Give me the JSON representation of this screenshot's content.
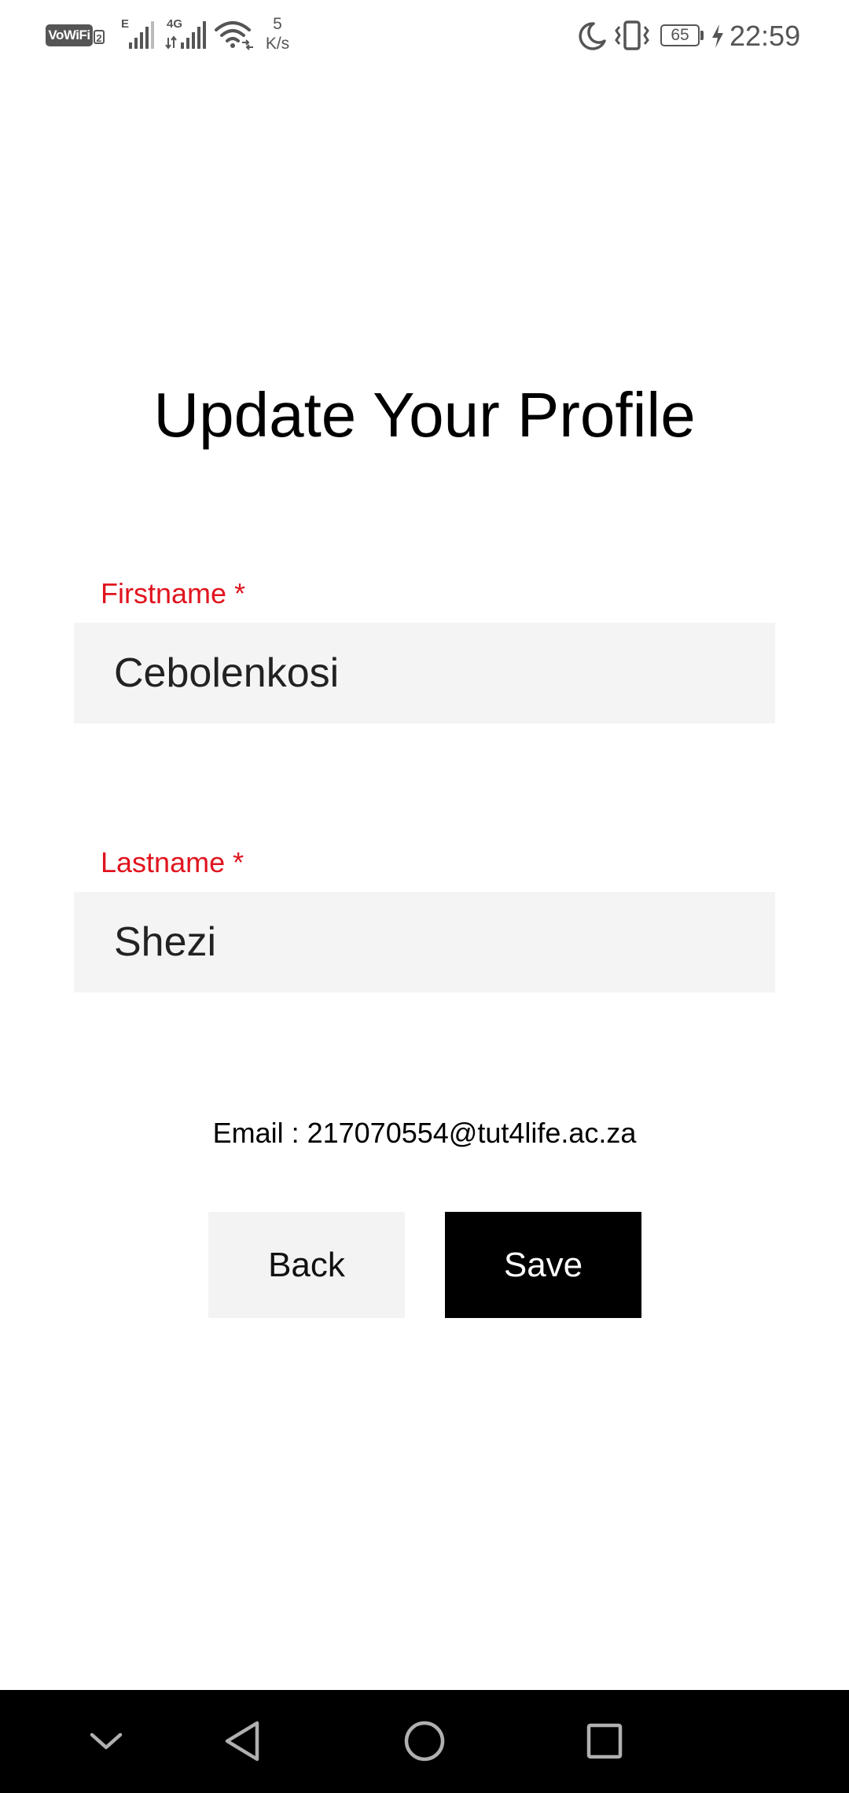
{
  "status_bar": {
    "vowifi_label": "VoWiFi",
    "vowifi_sim": "2",
    "network_type_1": "E",
    "network_type_2": "4G",
    "net_speed_value": "5",
    "net_speed_unit": "K/s",
    "battery_level": "65",
    "time": "22:59",
    "icons": [
      "vowifi-icon",
      "signal-icon",
      "signal-4g-icon",
      "wifi-icon",
      "moon-icon",
      "vibrate-icon",
      "battery-icon",
      "charging-icon"
    ]
  },
  "page": {
    "title": "Update Your Profile"
  },
  "form": {
    "firstname_label": "Firstname *",
    "firstname_value": "Cebolenkosi",
    "lastname_label": "Lastname *",
    "lastname_value": "Shezi",
    "email_text": "Email : 217070554@tut4life.ac.za"
  },
  "buttons": {
    "back_label": "Back",
    "save_label": "Save"
  },
  "nav_bar": {
    "icons": [
      "chevron-down-icon",
      "back-triangle-icon",
      "home-circle-icon",
      "recents-square-icon"
    ]
  },
  "colors": {
    "label_red": "#e0141e",
    "field_bg": "#f4f4f4",
    "save_bg": "#000000",
    "back_bg": "#f3f3f3",
    "status_gray": "#555555"
  }
}
